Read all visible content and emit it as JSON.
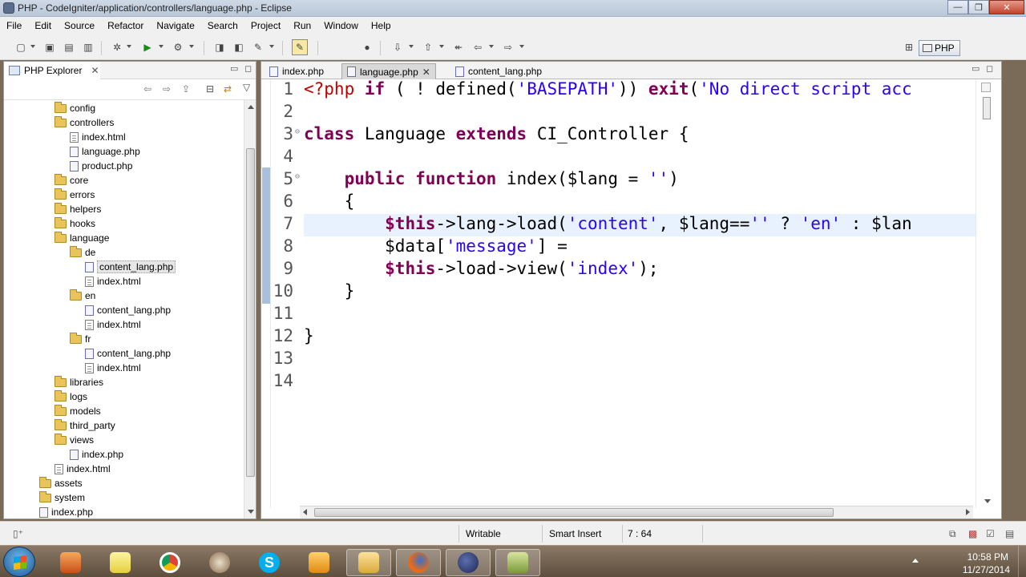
{
  "window": {
    "title": "PHP - CodeIgniter/application/controllers/language.php - Eclipse",
    "min_label": "—",
    "max_label": "❐",
    "close_label": "✕"
  },
  "menu": [
    "File",
    "Edit",
    "Source",
    "Refactor",
    "Navigate",
    "Search",
    "Project",
    "Run",
    "Window",
    "Help"
  ],
  "toolbar": {
    "perspective_label": "PHP"
  },
  "explorer": {
    "tab_label": "PHP Explorer",
    "tree": [
      {
        "label": "config",
        "type": "folder",
        "depth": 2
      },
      {
        "label": "controllers",
        "type": "folder",
        "depth": 2
      },
      {
        "label": "index.html",
        "type": "file",
        "depth": 3
      },
      {
        "label": "language.php",
        "type": "php",
        "depth": 3
      },
      {
        "label": "product.php",
        "type": "php",
        "depth": 3
      },
      {
        "label": "core",
        "type": "folder",
        "depth": 2
      },
      {
        "label": "errors",
        "type": "folder",
        "depth": 2
      },
      {
        "label": "helpers",
        "type": "folder",
        "depth": 2
      },
      {
        "label": "hooks",
        "type": "folder",
        "depth": 2
      },
      {
        "label": "language",
        "type": "folder",
        "depth": 2
      },
      {
        "label": "de",
        "type": "folder",
        "depth": 3
      },
      {
        "label": "content_lang.php",
        "type": "php",
        "depth": 4,
        "selected": true
      },
      {
        "label": "index.html",
        "type": "file",
        "depth": 4
      },
      {
        "label": "en",
        "type": "folder",
        "depth": 3
      },
      {
        "label": "content_lang.php",
        "type": "php",
        "depth": 4
      },
      {
        "label": "index.html",
        "type": "file",
        "depth": 4
      },
      {
        "label": "fr",
        "type": "folder",
        "depth": 3
      },
      {
        "label": "content_lang.php",
        "type": "php",
        "depth": 4
      },
      {
        "label": "index.html",
        "type": "file",
        "depth": 4
      },
      {
        "label": "libraries",
        "type": "folder",
        "depth": 2
      },
      {
        "label": "logs",
        "type": "folder",
        "depth": 2
      },
      {
        "label": "models",
        "type": "folder",
        "depth": 2
      },
      {
        "label": "third_party",
        "type": "folder",
        "depth": 2
      },
      {
        "label": "views",
        "type": "folder",
        "depth": 2
      },
      {
        "label": "index.php",
        "type": "php",
        "depth": 3
      },
      {
        "label": "index.html",
        "type": "file",
        "depth": 2
      },
      {
        "label": "assets",
        "type": "folder",
        "depth": 1
      },
      {
        "label": "system",
        "type": "folder",
        "depth": 1
      },
      {
        "label": "index.php",
        "type": "php",
        "depth": 1
      }
    ]
  },
  "editor": {
    "tabs": [
      {
        "label": "index.php",
        "active": false
      },
      {
        "label": "language.php",
        "active": true
      },
      {
        "label": "content_lang.php",
        "active": false
      }
    ],
    "current_line": 7,
    "lines": [
      {
        "n": "1",
        "fold": "",
        "html": "<span class=\"tag\">&lt;?php</span> <span class=\"kw\">if</span> ( ! defined(<span class=\"str\">'BASEPATH'</span>)) <span class=\"kw\">exit</span>(<span class=\"str\">'No direct script acc</span>"
      },
      {
        "n": "2",
        "fold": "",
        "html": ""
      },
      {
        "n": "3",
        "fold": "⊖",
        "html": "<span class=\"kw\">class</span> Language <span class=\"kw\">extends</span> CI_Controller {"
      },
      {
        "n": "4",
        "fold": "",
        "html": ""
      },
      {
        "n": "5",
        "fold": "⊖",
        "html": "    <span class=\"kw\">public</span> <span class=\"kw\">function</span> index($lang = <span class=\"str\">''</span>)"
      },
      {
        "n": "6",
        "fold": "",
        "html": "    {"
      },
      {
        "n": "7",
        "fold": "",
        "html": "        <span class=\"thisv\">$this</span>-&gt;lang-&gt;load(<span class=\"str\">'content'</span>, $lang==<span class=\"str\">''</span> ? <span class=\"str\">'en'</span> : $lan"
      },
      {
        "n": "8",
        "fold": "",
        "html": "        $data[<span class=\"str\">'message'</span>] ="
      },
      {
        "n": "9",
        "fold": "",
        "html": "        <span class=\"thisv\">$this</span>-&gt;load-&gt;view(<span class=\"str\">'index'</span>);"
      },
      {
        "n": "10",
        "fold": "",
        "html": "    }"
      },
      {
        "n": "11",
        "fold": "",
        "html": ""
      },
      {
        "n": "12",
        "fold": "",
        "html": "}"
      },
      {
        "n": "13",
        "fold": "",
        "html": ""
      },
      {
        "n": "14",
        "fold": "",
        "html": ""
      }
    ]
  },
  "status": {
    "writable": "Writable",
    "insert_mode": "Smart Insert",
    "position": "7 : 64"
  },
  "taskbar": {
    "time": "10:58 PM",
    "date": "11/27/2014"
  },
  "colors": {
    "keyword": "#7f0055",
    "string": "#2a00ff",
    "php_tag": "#c00000",
    "current_line": "#e8f2fe"
  }
}
